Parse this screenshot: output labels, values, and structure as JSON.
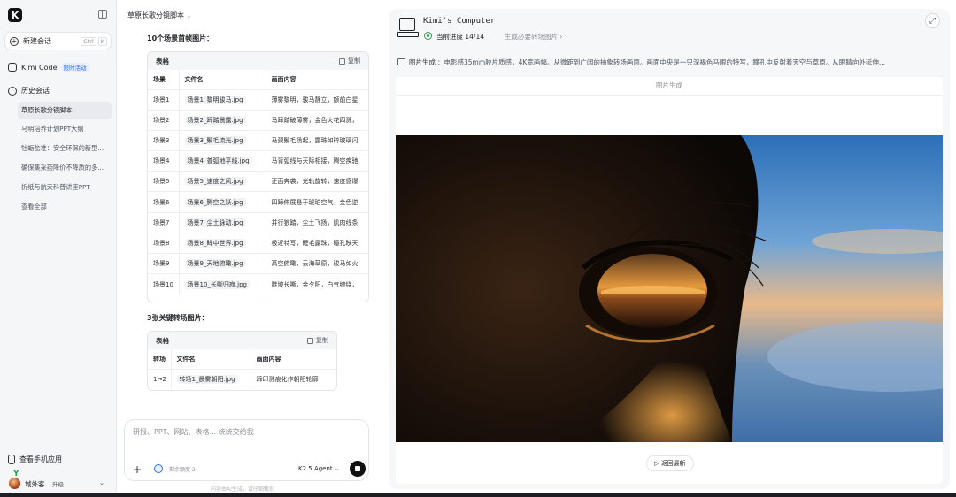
{
  "sidebar": {
    "logo": "K",
    "new_chat": {
      "label": "新建会话",
      "shortcut_keys": [
        "Ctrl",
        "K"
      ]
    },
    "kimi_code": {
      "label": "Kimi Code",
      "badge": "限时活动"
    },
    "history_label": "历史会话",
    "history_items": [
      {
        "label": "草原长歌分镜脚本",
        "active": true
      },
      {
        "label": "马明培养计划PPT大纲",
        "active": false
      },
      {
        "label": "牡蛎盐堆：安全环保的新型...",
        "active": false
      },
      {
        "label": "确保集采药降价不降质的多...",
        "active": false
      },
      {
        "label": "折纸与航天科普讲座PPT",
        "active": false
      },
      {
        "label": "查看全部",
        "active": false
      }
    ],
    "mobile_app": "查看手机应用",
    "user": {
      "name": "城外客",
      "upgrade": "升级"
    }
  },
  "chat": {
    "title": "草原长歌分镜脚本",
    "section1_title": "10个场景首帧图片：",
    "table1": {
      "label": "表格",
      "copy_label": "复制",
      "headers": [
        "场景",
        "文件名",
        "画面内容"
      ],
      "rows": [
        [
          "场景1",
          "场景1_黎明骏马.jpg",
          "薄雾黎明，骏马静立，额前白星"
        ],
        [
          "场景2",
          "场景2_蹄踏晨露.jpg",
          "马蹄踏破薄雾，金色火花四溅，"
        ],
        [
          "场景3",
          "场景3_鬃毛流光.jpg",
          "马颈鬃毛扬起，露珠如碎玻璃闪"
        ],
        [
          "场景4",
          "场景4_普弧地平线.jpg",
          "马背弧线与天际相接，腾空疾驰"
        ],
        [
          "场景5",
          "场景5_速度之风.jpg",
          "正面奔袭，光轨旋转，速度感爆"
        ],
        [
          "场景6",
          "场景6_腾空之跃.jpg",
          "四蹄伸展悬于琥珀空气，金色逆"
        ],
        [
          "场景7",
          "场景7_尘土脉动.jpg",
          "并行狼踏，尘土飞扬，肌肉线条"
        ],
        [
          "场景8",
          "场景8_眸中世界.jpg",
          "极近特写，睫毛露珠，瞳孔映天"
        ],
        [
          "场景9",
          "场景9_天地俯瞰.jpg",
          "高空俯瞰，云海草原，骏马如火"
        ],
        [
          "场景10",
          "场景10_长嘶归寂.jpg",
          "陡坡长嘶，金夕阳，白气缭绕，"
        ]
      ]
    },
    "section2_title": "3张关键转场图片：",
    "table2": {
      "label": "表格",
      "copy_label": "复制",
      "headers": [
        "转场",
        "文件名",
        "画面内容"
      ],
      "rows": [
        [
          "1→2",
          "转场1_晨雾朝阳.jpg",
          "蹄印溅痕化作朝阳轮廓"
        ]
      ]
    },
    "composer": {
      "placeholder": "研报、PPT、网站、表格... 统统交给我",
      "think_label": "剩余额度 2",
      "model": "K2.5 Agent"
    },
    "disclaimer": "内容由AI生成，请仔细甄别"
  },
  "computer": {
    "title": "Kimi's Computer",
    "progress_label": "当前进度 14/14",
    "progress_step": "生成必要转场图片",
    "tool_name": "图片生成",
    "tool_desc": "：电影感35mm胶片质感，4K宽画幅。从微距到广阔的抽象转场画面。画面中央是一只深褐色马眼的特写，瞳孔中反射着天空与草原。从眼睛向外延伸...",
    "panel_title": "图片生成",
    "back_label": "返回最新"
  }
}
